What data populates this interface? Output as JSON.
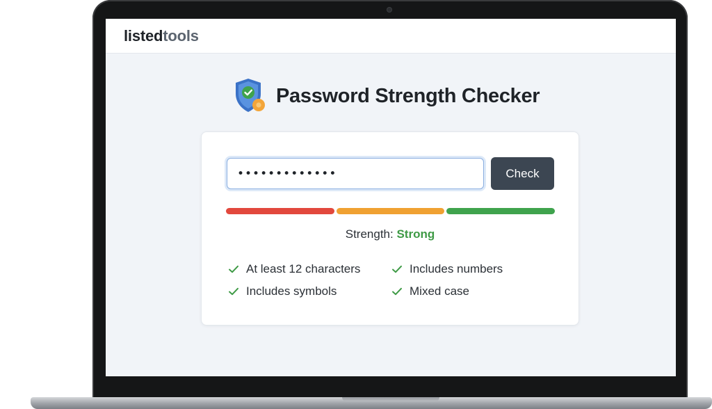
{
  "brand": {
    "part1": "listed",
    "part2": "tools"
  },
  "page": {
    "title": "Password Strength Checker",
    "icon": "shield-check-icon"
  },
  "form": {
    "password_value": "•••••••••••••",
    "check_label": "Check"
  },
  "meter": {
    "segments": [
      {
        "color": "#e2483d"
      },
      {
        "color": "#f0a132"
      },
      {
        "color": "#3fa34d"
      }
    ],
    "level": "3/3"
  },
  "strength": {
    "label": "Strength:",
    "value": "Strong"
  },
  "criteria": [
    {
      "label": "At least 12 characters",
      "met": true
    },
    {
      "label": "Includes numbers",
      "met": true
    },
    {
      "label": "Includes symbols",
      "met": true
    },
    {
      "label": "Mixed case",
      "met": true
    }
  ],
  "colors": {
    "accent_green": "#3e9a45",
    "button_bg": "#3c4652",
    "screen_bg": "#f1f4f8"
  }
}
